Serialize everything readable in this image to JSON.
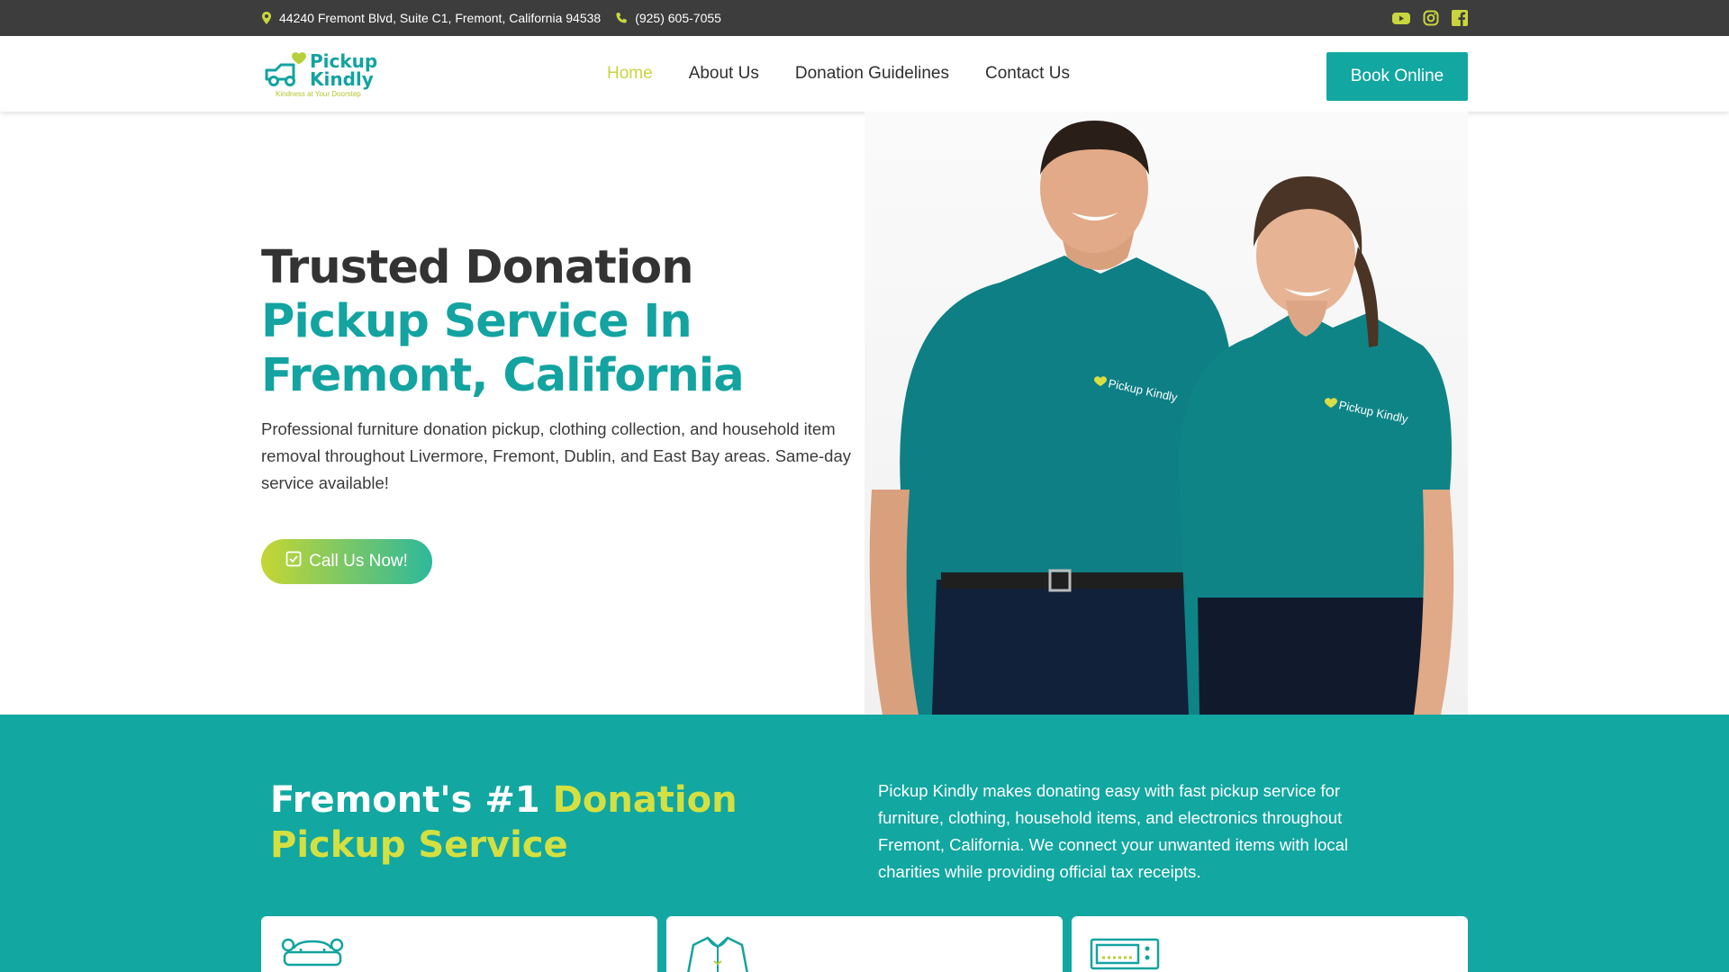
{
  "topbar": {
    "address": "44240 Fremont Blvd, Suite C1, Fremont, California 94538",
    "phone": "(925) 605-7055",
    "icons": [
      "location-pin-icon",
      "phone-icon",
      "youtube-icon",
      "instagram-icon",
      "facebook-icon"
    ]
  },
  "header": {
    "logo_word_1": "Pickup",
    "logo_word_2": "Kindly",
    "logo_tagline": "Kindness at Your Doorstep",
    "nav": [
      {
        "label": "Home",
        "active": true
      },
      {
        "label": "About Us",
        "active": false
      },
      {
        "label": "Donation Guidelines",
        "active": false
      },
      {
        "label": "Contact Us",
        "active": false
      }
    ],
    "book_label": "Book Online"
  },
  "hero": {
    "title_part1": "Trusted Donation ",
    "title_part2": "Pickup Service In Fremont, California",
    "description": "Professional furniture donation pickup, clothing collection, and household item removal throughout Livermore, Fremont, Dublin, and East Bay areas. Same-day service available!",
    "cta_label": "Call Us Now!",
    "photo_shirt_logo_1": "Pickup Kindly",
    "photo_shirt_logo_2": "Pickup Kindly"
  },
  "section": {
    "title_part1": "Fremont's #1 ",
    "title_part2": "Donation Pickup Service",
    "description": "Pickup Kindly makes donating easy with fast pickup service for furniture, clothing, household items, and electronics throughout Fremont, California. We connect your unwanted items with local charities while providing official tax receipts.",
    "card_icons": [
      "furniture-icon",
      "clothing-icon",
      "electronics-icon"
    ]
  },
  "colors": {
    "teal": "#12a7a1",
    "lime": "#c9d53f",
    "topbar_bg": "#3d3d3d"
  }
}
